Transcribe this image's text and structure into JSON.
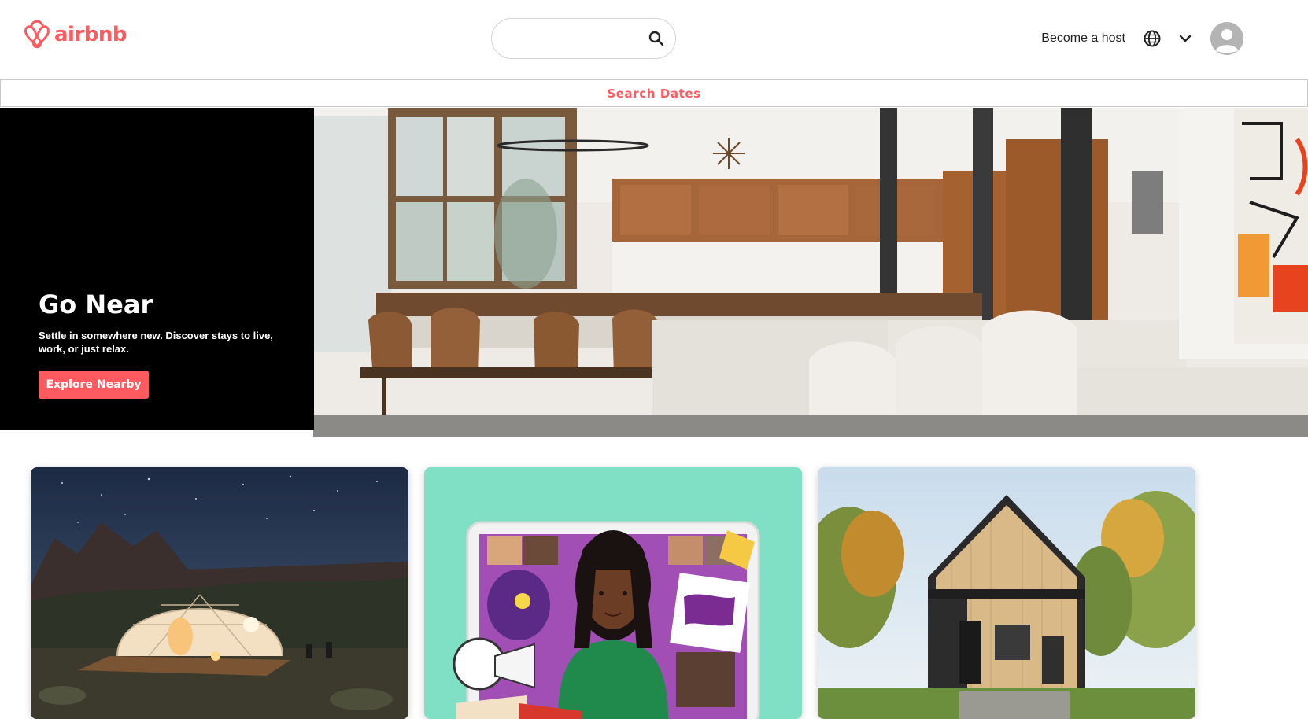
{
  "header": {
    "logo_text": "airbnb",
    "logo_icon": "airbnb-belo-icon",
    "search": {
      "value": "",
      "placeholder": "",
      "icon": "search-icon"
    },
    "become_host_label": "Become a host",
    "globe_icon": "globe-icon",
    "chevron_icon": "chevron-down-icon",
    "avatar_icon": "user-avatar-icon"
  },
  "search_dates": {
    "label": "Search Dates"
  },
  "hero": {
    "title": "Go Near",
    "subtitle": "Settle in somewhere new. Discover stays to live, work, or just relax.",
    "button_label": "Explore Nearby"
  },
  "cards": [
    {
      "image": "geodesic-dome-at-night"
    },
    {
      "image": "woman-with-online-experiences-collage"
    },
    {
      "image": "wooden-cabin-in-forest"
    }
  ],
  "colors": {
    "brand": "#ff5a5f",
    "text": "#222222",
    "hero_panel": "#000000",
    "card2_bg": "#7fe0c6"
  }
}
